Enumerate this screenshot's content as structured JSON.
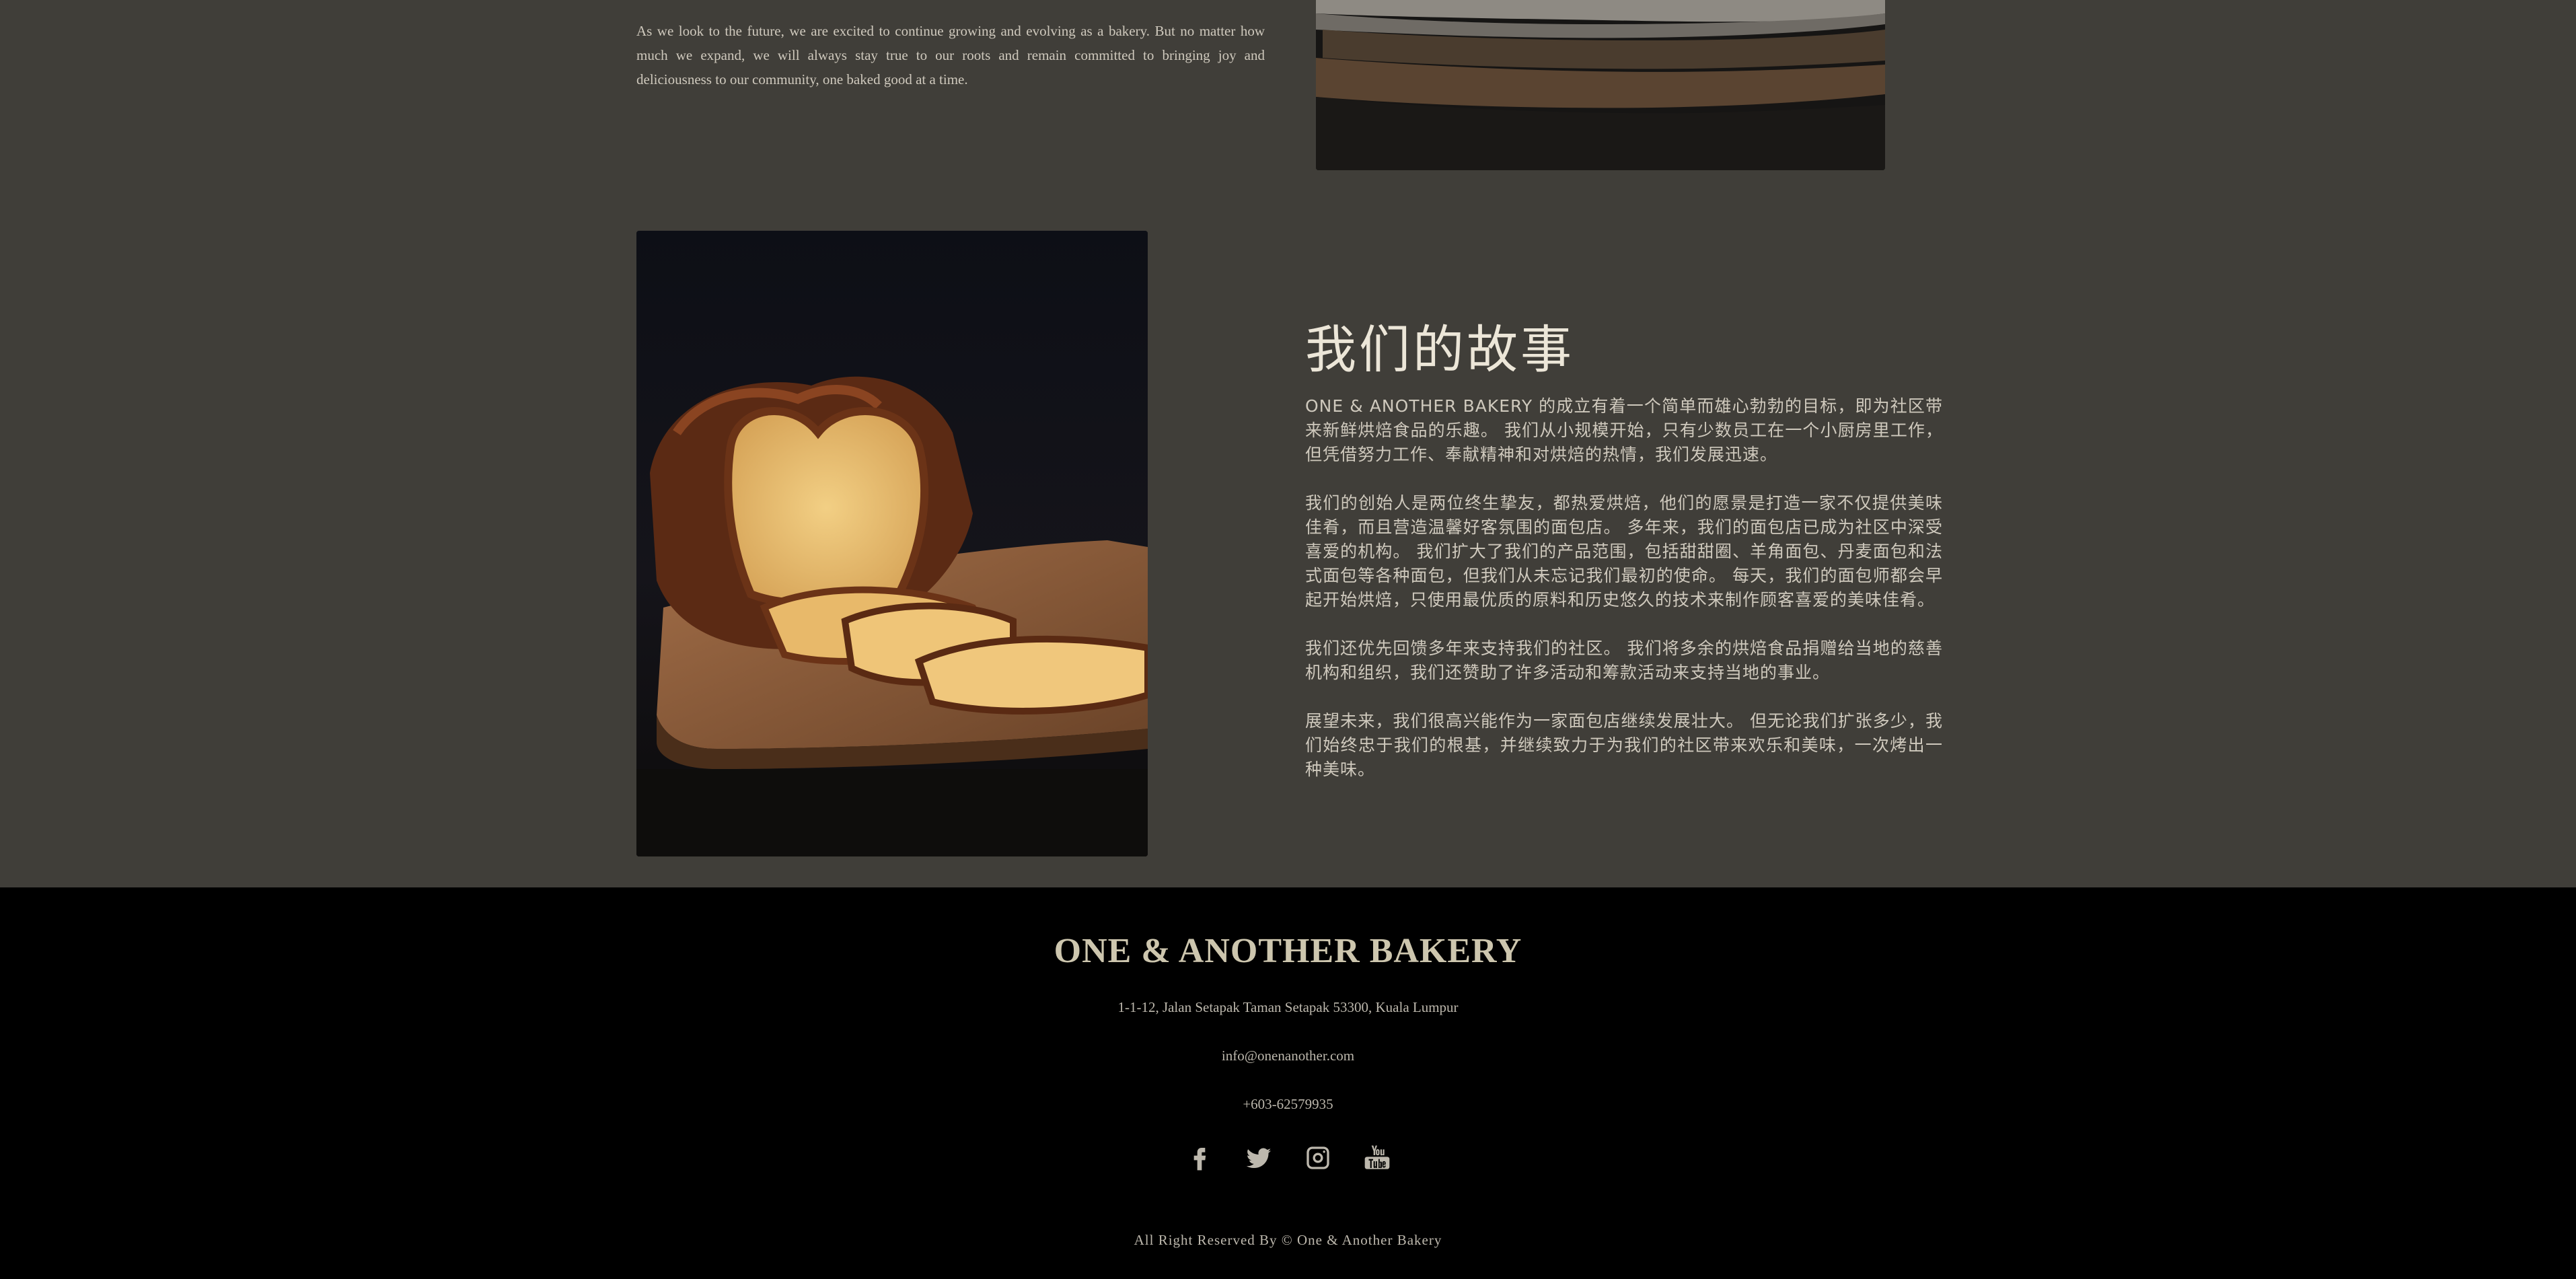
{
  "top": {
    "paragraph": "As we look to the future, we are excited to continue growing and evolving as a bakery. But no matter how much we expand, we will always stay true to our roots and remain committed to bringing joy and deliciousness to our community, one baked good at a time."
  },
  "story": {
    "title": "我们的故事",
    "paragraphs": [
      "ONE & ANOTHER BAKERY 的成立有着一个简单而雄心勃勃的目标，即为社区带来新鲜烘焙食品的乐趣。 我们从小规模开始，只有少数员工在一个小厨房里工作，但凭借努力工作、奉献精神和对烘焙的热情，我们发展迅速。",
      "我们的创始人是两位终生挚友，都热爱烘焙，他们的愿景是打造一家不仅提供美味佳肴，而且营造温馨好客氛围的面包店。 多年来，我们的面包店已成为社区中深受喜爱的机构。 我们扩大了我们的产品范围，包括甜甜圈、羊角面包、丹麦面包和法式面包等各种面包，但我们从未忘记我们最初的使命。 每天，我们的面包师都会早起开始烘焙，只使用最优质的原料和历史悠久的技术来制作顾客喜爱的美味佳肴。",
      "我们还优先回馈多年来支持我们的社区。 我们将多余的烘焙食品捐赠给当地的慈善机构和组织，我们还赞助了许多活动和筹款活动来支持当地的事业。",
      "展望未来，我们很高兴能作为一家面包店继续发展壮大。 但无论我们扩张多少，我们始终忠于我们的根基，并继续致力于为我们的社区带来欢乐和美味，一次烤出一种美味。"
    ]
  },
  "footer": {
    "brand": "ONE & ANOTHER BAKERY",
    "address": "1-1-12, Jalan Setapak Taman Setapak 53300, Kuala Lumpur",
    "email": "info@onenanother.com",
    "phone": "+603-62579935",
    "social_icons": [
      "facebook-icon",
      "twitter-icon",
      "instagram-icon",
      "youtube-icon"
    ],
    "copyright": "All Right Reserved By © One & Another Bakery"
  },
  "colors": {
    "background": "#403e39",
    "footer_bg": "#000000",
    "brand": "#cdc6ae",
    "heading": "#ece6d8"
  }
}
